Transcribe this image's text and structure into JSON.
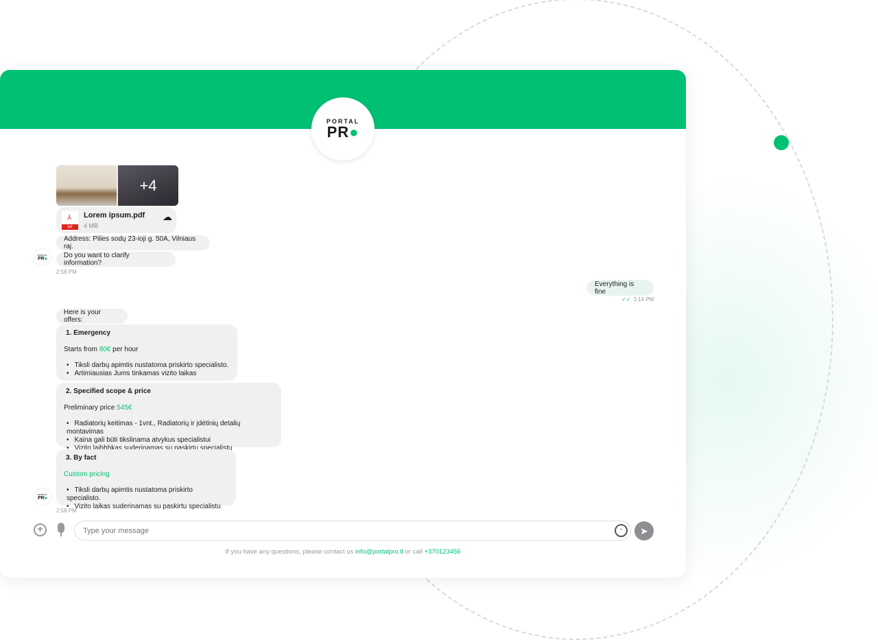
{
  "brand": {
    "top": "PORTAL",
    "bottom": "PR",
    "accent": "#00c073"
  },
  "attachments": {
    "more_count": "+4",
    "file": {
      "name": "Lorem ipsum.pdf",
      "size": "4 MB",
      "type": "pdf"
    }
  },
  "messages": {
    "address": "Address: Pilies sodų 23-ioji g. 50A, Vilniaus raj.",
    "clarify": "Do you want to clarify information?",
    "time1": "2:58 PM",
    "reply": "Everything is fine",
    "reply_time": "3:14 PM",
    "offers_intro": "Here is your offers:",
    "time2": "2:58 PM"
  },
  "offers": [
    {
      "title": "1. Emergency",
      "pre": "Starts from ",
      "price": "80€",
      "post": " per hour",
      "bullets": [
        "Tiksli darbų apimtis nustatoma priskirto specialisto.",
        "Artimiausias Jums tinkamas vizito laikas"
      ]
    },
    {
      "title": "2. Specified scope & price",
      "pre": "Preliminary price ",
      "price": "545€",
      "post": "",
      "bullets": [
        "Radiatorių keitimas - 1vnt., Radiatorių ir įdėtinių detalių montavimas",
        "Kaina gali būti tikslinama atvykus specialistui",
        "Vizito laihhhkas suderinamas su paskirtu specialistu"
      ]
    },
    {
      "title": "3. By fact",
      "pre": "",
      "price": "Custom pricing",
      "post": "",
      "bullets": [
        "Tiksli darbų apimtis nustatoma priskirto specialisto.",
        "Vizito laikas suderinamas su paskirtu specialistu"
      ]
    }
  ],
  "composer": {
    "placeholder": "Type your message"
  },
  "footer": {
    "text": "If you have any questions, please contact us ",
    "email": "info@portalpro.lt",
    "mid": " or call ",
    "phone": "+370123456"
  }
}
